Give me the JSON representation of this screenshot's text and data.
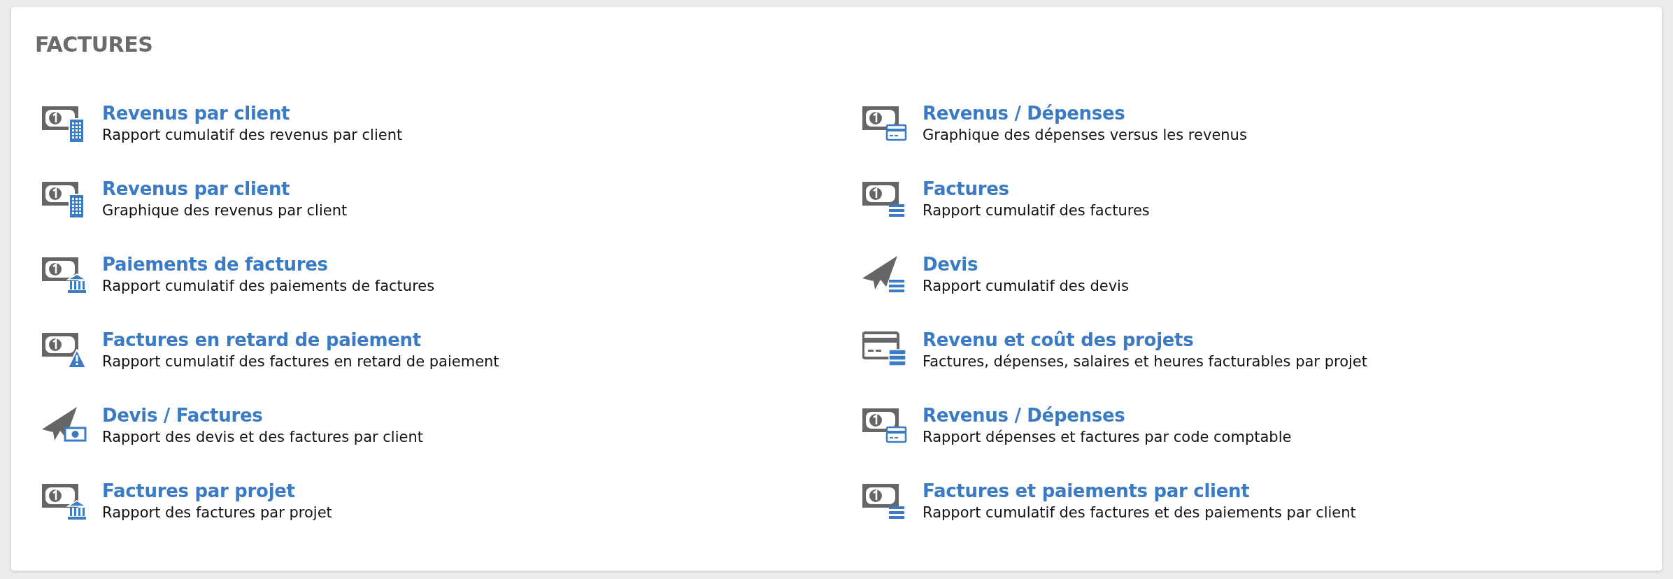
{
  "section_title": "FACTURES",
  "columns": [
    {
      "reports": [
        {
          "title": "Revenus par client",
          "description": "Rapport cumulatif des revenus par client"
        },
        {
          "title": "Revenus par client",
          "description": "Graphique des revenus par client"
        },
        {
          "title": "Paiements de factures",
          "description": "Rapport cumulatif des paiements de factures"
        },
        {
          "title": "Factures en retard de paiement",
          "description": "Rapport cumulatif des factures en retard de paiement"
        },
        {
          "title": "Devis / Factures",
          "description": "Rapport des devis et des factures par client"
        },
        {
          "title": "Factures par projet",
          "description": "Rapport des factures par projet"
        }
      ]
    },
    {
      "reports": [
        {
          "title": "Revenus / Dépenses",
          "description": "Graphique des dépenses versus les revenus"
        },
        {
          "title": "Factures",
          "description": "Rapport cumulatif des factures"
        },
        {
          "title": "Devis",
          "description": "Rapport cumulatif des devis"
        },
        {
          "title": "Revenu et coût des projets",
          "description": "Factures, dépenses, salaires et heures facturables par projet"
        },
        {
          "title": "Revenus / Dépenses",
          "description": "Rapport dépenses et factures par code comptable"
        },
        {
          "title": "Factures et paiements par client",
          "description": "Rapport cumulatif des factures et des paiements par client"
        }
      ]
    }
  ]
}
